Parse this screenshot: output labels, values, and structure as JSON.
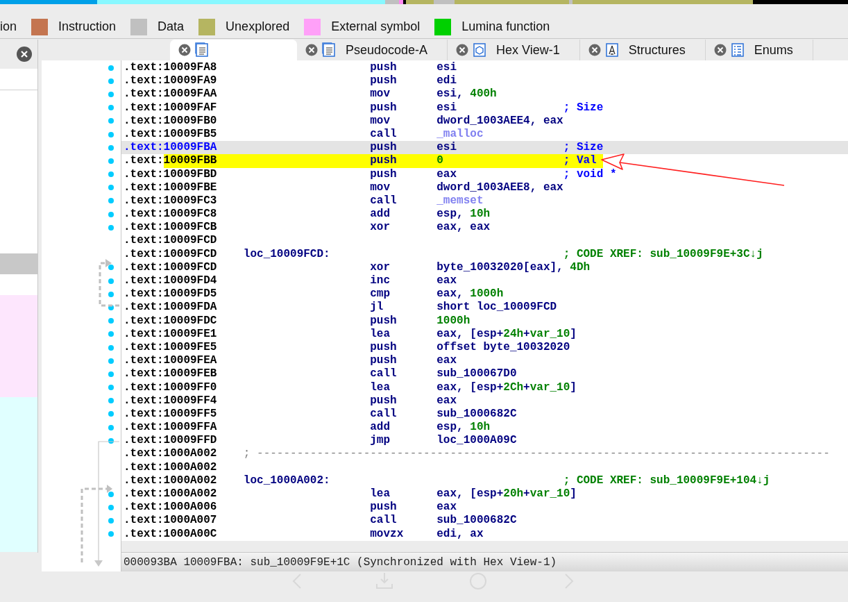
{
  "legend": [
    {
      "label": "ion"
    },
    {
      "label": "Instruction",
      "color": "#c47550"
    },
    {
      "label": "Data",
      "color": "#c0c0c0"
    },
    {
      "label": "Unexplored",
      "color": "#b5b561"
    },
    {
      "label": "External symbol",
      "color": "#ffa0f8"
    },
    {
      "label": "Lumina function",
      "color": "#00d000"
    }
  ],
  "tabs": [
    {
      "kind": "listing",
      "selected": true
    },
    {
      "kind": "pseudocode",
      "label": "Pseudocode-A",
      "selected": false
    },
    {
      "kind": "hex",
      "label": "Hex View-1",
      "selected": false
    },
    {
      "kind": "structures",
      "label": "Structures",
      "selected": false
    },
    {
      "kind": "enums",
      "label": "Enums",
      "selected": false
    }
  ],
  "rows": [
    {
      "kind": "instruction",
      "address": ".text:10009FA8",
      "mnemonic": "push",
      "operands": [
        {
          "kind": "text",
          "text": "esi"
        }
      ],
      "marked": true,
      "selected": false,
      "highlighted": false
    },
    {
      "kind": "instruction",
      "address": ".text:10009FA9",
      "mnemonic": "push",
      "operands": [
        {
          "kind": "text",
          "text": "edi"
        }
      ],
      "marked": true,
      "selected": false,
      "highlighted": false
    },
    {
      "kind": "instruction",
      "address": ".text:10009FAA",
      "mnemonic": "mov",
      "operands": [
        {
          "kind": "text",
          "text": "esi, "
        },
        {
          "kind": "number",
          "text": "400h"
        }
      ],
      "marked": true,
      "selected": false,
      "highlighted": false
    },
    {
      "kind": "instruction",
      "address": ".text:10009FAF",
      "mnemonic": "push",
      "operands": [
        {
          "kind": "text",
          "text": "esi"
        }
      ],
      "comment": {
        "kind": "arg",
        "text": "; Size"
      },
      "marked": true,
      "selected": false,
      "highlighted": false
    },
    {
      "kind": "instruction",
      "address": ".text:10009FB0",
      "mnemonic": "mov",
      "operands": [
        {
          "kind": "text",
          "text": "dword_1003AEE4, eax"
        }
      ],
      "marked": true,
      "selected": false,
      "highlighted": false
    },
    {
      "kind": "instruction",
      "address": ".text:10009FB5",
      "mnemonic": "call",
      "operands": [
        {
          "kind": "import",
          "text": "_malloc"
        }
      ],
      "marked": true,
      "selected": false,
      "highlighted": false
    },
    {
      "kind": "instruction",
      "address": ".text:10009FBA",
      "mnemonic": "push",
      "operands": [
        {
          "kind": "text",
          "text": "esi"
        }
      ],
      "comment": {
        "kind": "arg",
        "text": "; Size"
      },
      "marked": true,
      "selected": true,
      "highlighted": false
    },
    {
      "kind": "instruction",
      "address": ".text:10009FBB",
      "mnemonic": "push",
      "operands": [
        {
          "kind": "number",
          "text": "0"
        }
      ],
      "comment": {
        "kind": "arg",
        "text": "; Val"
      },
      "marked": true,
      "selected": false,
      "highlighted": true
    },
    {
      "kind": "instruction",
      "address": ".text:10009FBD",
      "mnemonic": "push",
      "operands": [
        {
          "kind": "text",
          "text": "eax"
        }
      ],
      "comment": {
        "kind": "arg",
        "text": "; void *"
      },
      "marked": true,
      "selected": false,
      "highlighted": false
    },
    {
      "kind": "instruction",
      "address": ".text:10009FBE",
      "mnemonic": "mov",
      "operands": [
        {
          "kind": "text",
          "text": "dword_1003AEE8, eax"
        }
      ],
      "marked": true,
      "selected": false,
      "highlighted": false
    },
    {
      "kind": "instruction",
      "address": ".text:10009FC3",
      "mnemonic": "call",
      "operands": [
        {
          "kind": "import",
          "text": "_memset"
        }
      ],
      "marked": true,
      "selected": false,
      "highlighted": false
    },
    {
      "kind": "instruction",
      "address": ".text:10009FC8",
      "mnemonic": "add",
      "operands": [
        {
          "kind": "text",
          "text": "esp, "
        },
        {
          "kind": "number",
          "text": "10h"
        }
      ],
      "marked": true,
      "selected": false,
      "highlighted": false
    },
    {
      "kind": "instruction",
      "address": ".text:10009FCB",
      "mnemonic": "xor",
      "operands": [
        {
          "kind": "text",
          "text": "eax, eax"
        }
      ],
      "marked": true,
      "selected": false,
      "highlighted": false
    },
    {
      "kind": "blank",
      "address": ".text:10009FCD",
      "marked": false,
      "selected": false,
      "highlighted": false
    },
    {
      "kind": "label",
      "address": ".text:10009FCD",
      "label": "loc_10009FCD:",
      "comment": {
        "kind": "xref",
        "text": "; CODE XREF: sub_10009F9E+3C↓j"
      },
      "marked": false,
      "selected": false,
      "highlighted": false
    },
    {
      "kind": "instruction",
      "address": ".text:10009FCD",
      "mnemonic": "xor",
      "operands": [
        {
          "kind": "text",
          "text": "byte_10032020[eax], "
        },
        {
          "kind": "number",
          "text": "4Dh"
        }
      ],
      "marked": true,
      "selected": false,
      "highlighted": false
    },
    {
      "kind": "instruction",
      "address": ".text:10009FD4",
      "mnemonic": "inc",
      "operands": [
        {
          "kind": "text",
          "text": "eax"
        }
      ],
      "marked": true,
      "selected": false,
      "highlighted": false
    },
    {
      "kind": "instruction",
      "address": ".text:10009FD5",
      "mnemonic": "cmp",
      "operands": [
        {
          "kind": "text",
          "text": "eax, "
        },
        {
          "kind": "number",
          "text": "1000h"
        }
      ],
      "marked": true,
      "selected": false,
      "highlighted": false
    },
    {
      "kind": "instruction",
      "address": ".text:10009FDA",
      "mnemonic": "jl",
      "operands": [
        {
          "kind": "text",
          "text": "short loc_10009FCD"
        }
      ],
      "marked": true,
      "selected": false,
      "highlighted": false
    },
    {
      "kind": "instruction",
      "address": ".text:10009FDC",
      "mnemonic": "push",
      "operands": [
        {
          "kind": "number",
          "text": "1000h"
        }
      ],
      "marked": true,
      "selected": false,
      "highlighted": false
    },
    {
      "kind": "instruction",
      "address": ".text:10009FE1",
      "mnemonic": "lea",
      "operands": [
        {
          "kind": "text",
          "text": "eax, [esp+"
        },
        {
          "kind": "number",
          "text": "24h"
        },
        {
          "kind": "text",
          "text": "+"
        },
        {
          "kind": "number",
          "text": "var_10"
        },
        {
          "kind": "text",
          "text": "]"
        }
      ],
      "marked": true,
      "selected": false,
      "highlighted": false
    },
    {
      "kind": "instruction",
      "address": ".text:10009FE5",
      "mnemonic": "push",
      "operands": [
        {
          "kind": "text",
          "text": "offset byte_10032020"
        }
      ],
      "marked": true,
      "selected": false,
      "highlighted": false
    },
    {
      "kind": "instruction",
      "address": ".text:10009FEA",
      "mnemonic": "push",
      "operands": [
        {
          "kind": "text",
          "text": "eax"
        }
      ],
      "marked": true,
      "selected": false,
      "highlighted": false
    },
    {
      "kind": "instruction",
      "address": ".text:10009FEB",
      "mnemonic": "call",
      "operands": [
        {
          "kind": "text",
          "text": "sub_100067D0"
        }
      ],
      "marked": true,
      "selected": false,
      "highlighted": false
    },
    {
      "kind": "instruction",
      "address": ".text:10009FF0",
      "mnemonic": "lea",
      "operands": [
        {
          "kind": "text",
          "text": "eax, [esp+"
        },
        {
          "kind": "number",
          "text": "2Ch"
        },
        {
          "kind": "text",
          "text": "+"
        },
        {
          "kind": "number",
          "text": "var_10"
        },
        {
          "kind": "text",
          "text": "]"
        }
      ],
      "marked": true,
      "selected": false,
      "highlighted": false
    },
    {
      "kind": "instruction",
      "address": ".text:10009FF4",
      "mnemonic": "push",
      "operands": [
        {
          "kind": "text",
          "text": "eax"
        }
      ],
      "marked": true,
      "selected": false,
      "highlighted": false
    },
    {
      "kind": "instruction",
      "address": ".text:10009FF5",
      "mnemonic": "call",
      "operands": [
        {
          "kind": "text",
          "text": "sub_1000682C"
        }
      ],
      "marked": true,
      "selected": false,
      "highlighted": false
    },
    {
      "kind": "instruction",
      "address": ".text:10009FFA",
      "mnemonic": "add",
      "operands": [
        {
          "kind": "text",
          "text": "esp, "
        },
        {
          "kind": "number",
          "text": "10h"
        }
      ],
      "marked": true,
      "selected": false,
      "highlighted": false
    },
    {
      "kind": "instruction",
      "address": ".text:10009FFD",
      "mnemonic": "jmp",
      "operands": [
        {
          "kind": "text",
          "text": "loc_1000A09C"
        }
      ],
      "marked": true,
      "selected": false,
      "highlighted": false
    },
    {
      "kind": "separator",
      "address": ".text:1000A002",
      "text": "; --------------------------------------------------------------------------------------",
      "marked": false,
      "selected": false,
      "highlighted": false
    },
    {
      "kind": "blank",
      "address": ".text:1000A002",
      "marked": false,
      "selected": false,
      "highlighted": false
    },
    {
      "kind": "label",
      "address": ".text:1000A002",
      "label": "loc_1000A002:",
      "comment": {
        "kind": "xref",
        "text": "; CODE XREF: sub_10009F9E+104↓j"
      },
      "marked": false,
      "selected": false,
      "highlighted": false
    },
    {
      "kind": "instruction",
      "address": ".text:1000A002",
      "mnemonic": "lea",
      "operands": [
        {
          "kind": "text",
          "text": "eax, [esp+"
        },
        {
          "kind": "number",
          "text": "20h"
        },
        {
          "kind": "text",
          "text": "+"
        },
        {
          "kind": "number",
          "text": "var_10"
        },
        {
          "kind": "text",
          "text": "]"
        }
      ],
      "marked": true,
      "selected": false,
      "highlighted": false
    },
    {
      "kind": "instruction",
      "address": ".text:1000A006",
      "mnemonic": "push",
      "operands": [
        {
          "kind": "text",
          "text": "eax"
        }
      ],
      "marked": true,
      "selected": false,
      "highlighted": false
    },
    {
      "kind": "instruction",
      "address": ".text:1000A007",
      "mnemonic": "call",
      "operands": [
        {
          "kind": "text",
          "text": "sub_1000682C"
        }
      ],
      "marked": true,
      "selected": false,
      "highlighted": false
    },
    {
      "kind": "instruction",
      "address": ".text:1000A00C",
      "mnemonic": "movzx",
      "operands": [
        {
          "kind": "text",
          "text": "edi, ax"
        }
      ],
      "marked": true,
      "selected": false,
      "highlighted": false
    }
  ],
  "status_bar": "000093BA 10009FBA: sub_10009F9E+1C (Synchronized with Hex View-1)"
}
